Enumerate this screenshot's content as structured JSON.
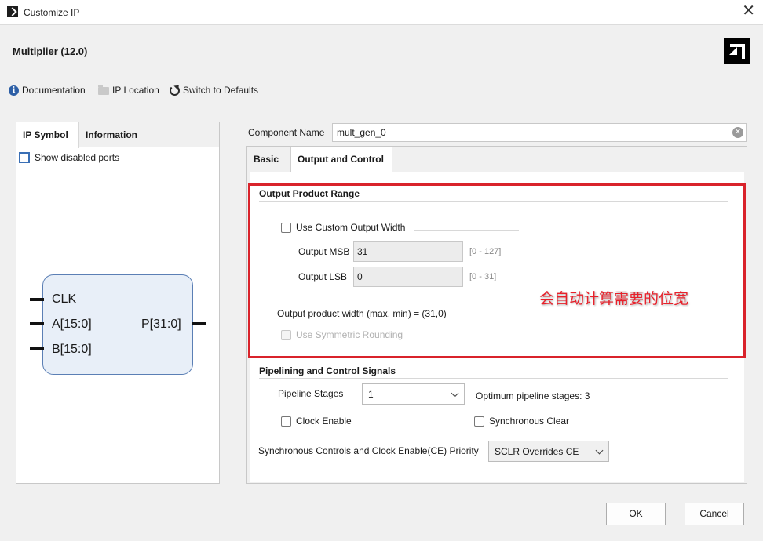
{
  "window": {
    "title": "Customize IP",
    "close_glyph": "✕"
  },
  "header": {
    "ip_name": "Multiplier (12.0)"
  },
  "toolbar": {
    "documentation": "Documentation",
    "ip_location": "IP Location",
    "switch_defaults": "Switch to Defaults"
  },
  "left_panel": {
    "tabs": [
      "IP Symbol",
      "Information"
    ],
    "show_disabled_ports": "Show disabled ports",
    "symbol": {
      "pins_left": [
        "CLK",
        "A[15:0]",
        "B[15:0]"
      ],
      "pins_right": [
        "P[31:0]"
      ]
    }
  },
  "component": {
    "label": "Component Name",
    "value": "mult_gen_0"
  },
  "right_panel": {
    "tabs": [
      "Basic",
      "Output and Control"
    ],
    "output_range": {
      "title": "Output Product Range",
      "use_custom_width": "Use Custom Output Width",
      "msb_label": "Output MSB",
      "msb_value": "31",
      "msb_range": "[0 - 127]",
      "lsb_label": "Output LSB",
      "lsb_value": "0",
      "lsb_range": "[0 - 31]",
      "product_width": "Output product width (max, min) = (31,0)",
      "symmetric_rounding": "Use Symmetric Rounding"
    },
    "pipelining": {
      "title": "Pipelining and Control Signals",
      "stages_label": "Pipeline Stages",
      "stages_value": "1",
      "optimum": "Optimum pipeline stages: 3",
      "clock_enable": "Clock Enable",
      "sync_clear": "Synchronous Clear",
      "priority_label": "Synchronous Controls and Clock Enable(CE) Priority",
      "priority_value": "SCLR Overrides CE"
    }
  },
  "annotation": {
    "text": "会自动计算需要的位宽",
    "color": "#e8202a"
  },
  "buttons": {
    "ok": "OK",
    "cancel": "Cancel"
  },
  "colors": {
    "highlight_box": "#d9232b",
    "symbol_fill": "#e8eff8",
    "symbol_border": "#5b7fb5",
    "info_icon": "#2d5fa6"
  }
}
